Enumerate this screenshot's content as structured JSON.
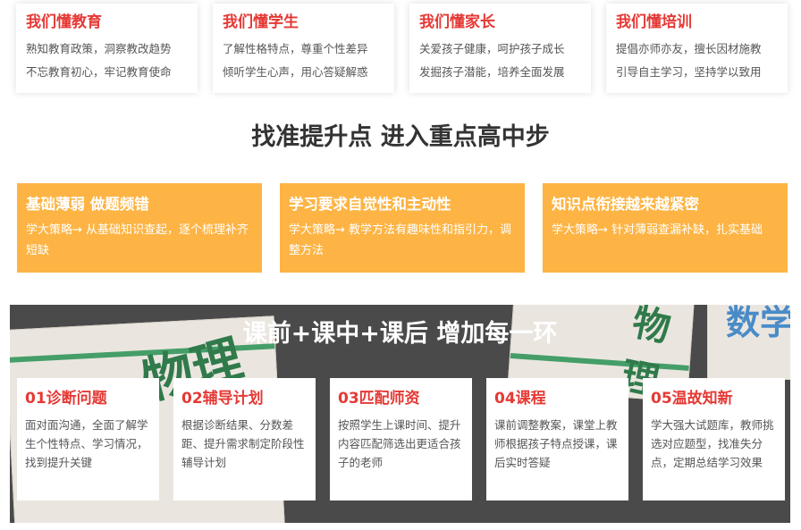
{
  "top_cards": [
    {
      "title": "我们懂教育",
      "line1": "熟知教育政策，洞察教改趋势",
      "line2": "不忘教育初心，牢记教育使命"
    },
    {
      "title": "我们懂学生",
      "line1": "了解性格特点，尊重个性差异",
      "line2": "倾听学生心声，用心答疑解惑"
    },
    {
      "title": "我们懂家长",
      "line1": "关爱孩子健康，呵护孩子成长",
      "line2": "发掘孩子潜能，培养全面发展"
    },
    {
      "title": "我们懂培训",
      "line1": "提倡亦师亦友，擅长因材施教",
      "line2": "引导自主学习，坚持学以致用"
    }
  ],
  "section_title": "找准提升点 进入重点高中步",
  "orange_cards": [
    {
      "title": "基础薄弱 做题频错",
      "desc": "学大策略→ 从基础知识查起，逐个梳理补齐短缺"
    },
    {
      "title": "学习要求自觉性和主动性",
      "desc": "学大策略→ 教学方法有趣味性和指引力，调整方法"
    },
    {
      "title": "知识点衔接越来越紧密",
      "desc": "学大策略→ 针对薄弱查漏补缺，扎实基础"
    }
  ],
  "band": {
    "title": "课前+课中+课后 增加每一环",
    "bg_texts": [
      "物理",
      "物理",
      "数学"
    ],
    "steps": [
      {
        "title": "01诊断问题",
        "desc": "面对面沟通，全面了解学生个性特点、学习情况，找到提升关键"
      },
      {
        "title": "02辅导计划",
        "desc": "根据诊断结果、分数差距、提升需求制定阶段性辅导计划"
      },
      {
        "title": "03匹配师资",
        "desc": "按照学生上课时间、提升内容匹配筛选出更适合孩子的老师"
      },
      {
        "title": "04课程",
        "desc": "课前调整教案，课堂上教师根据孩子特点授课，课后实时答疑"
      },
      {
        "title": "05温故知新",
        "desc": "学大强大试题库，教师挑选对应题型，找准失分点，定期总结学习效果"
      }
    ]
  },
  "colors": {
    "red": "#e53935",
    "orange": "#fdb444",
    "dark": "#4a4a4a",
    "text": "#555555"
  }
}
